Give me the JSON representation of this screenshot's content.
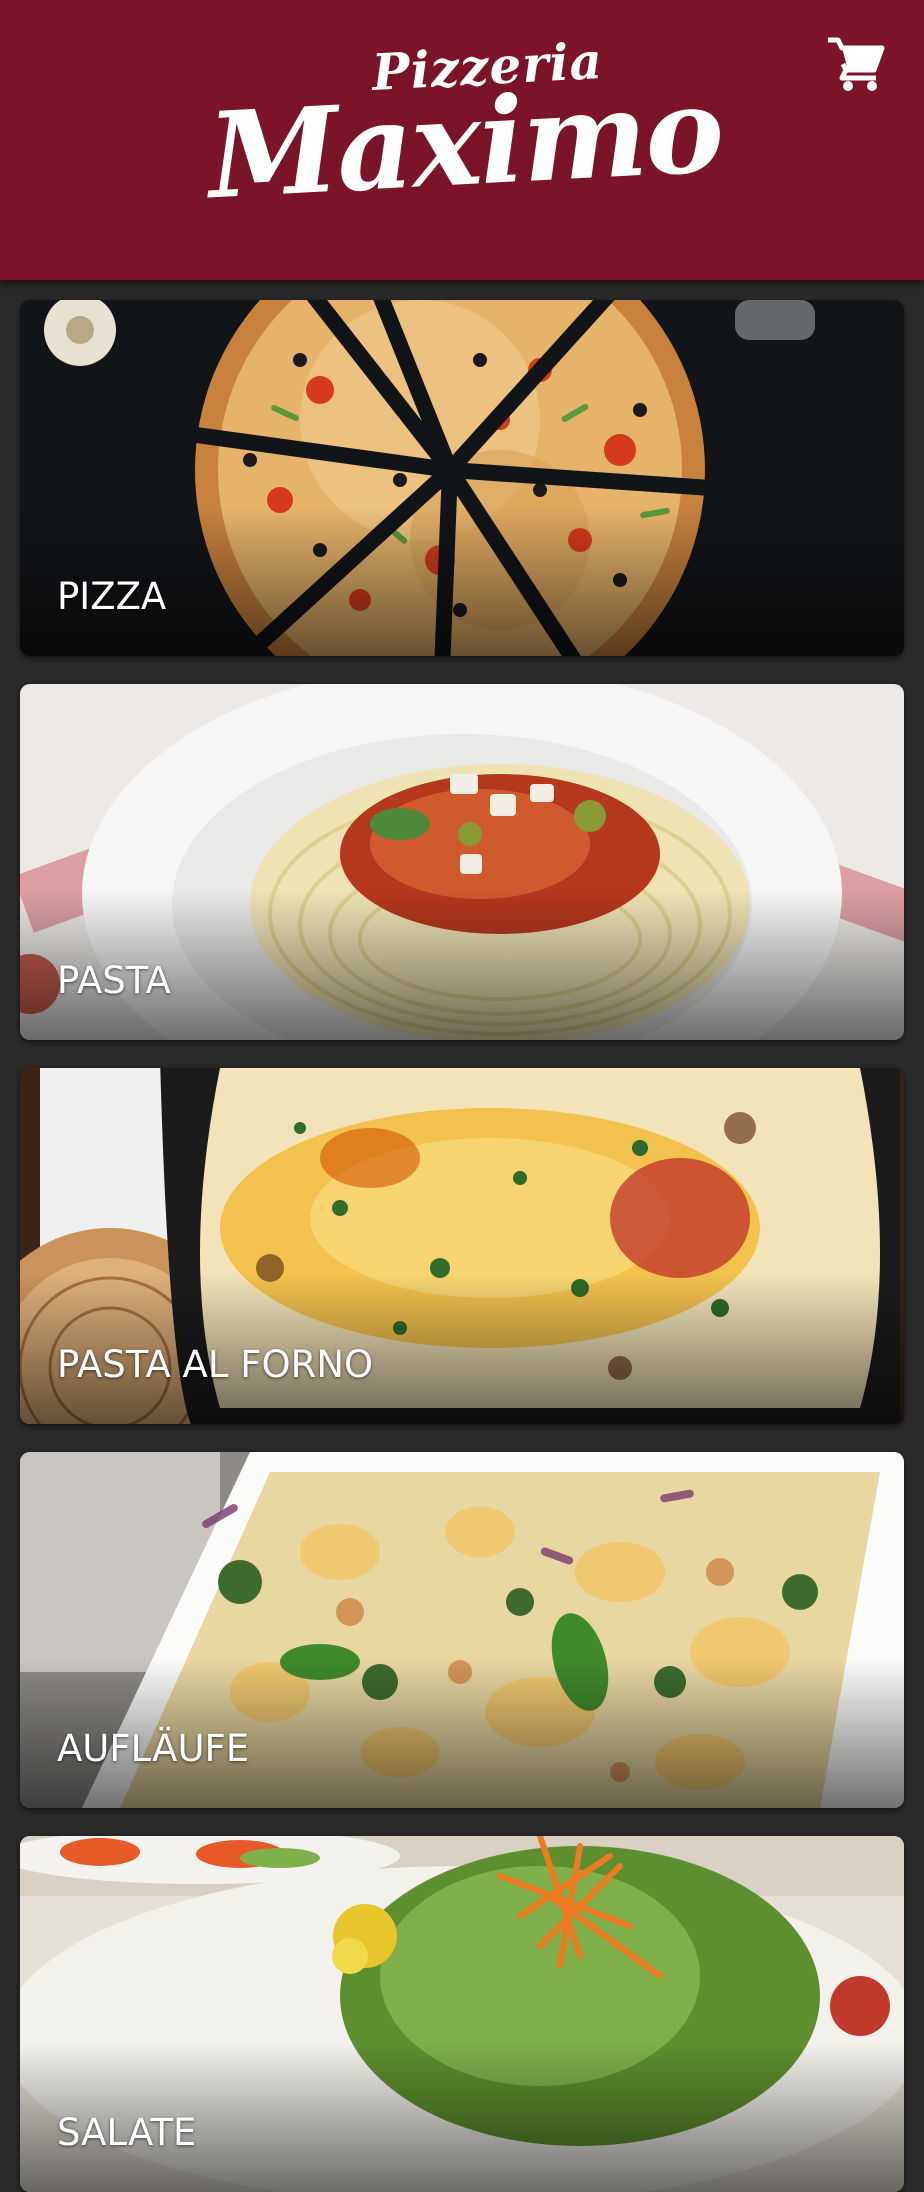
{
  "header": {
    "brand_top": "Pizzeria",
    "brand_main": "Maximo",
    "cart_icon": "shopping-cart-icon",
    "background": "#7b1428"
  },
  "categories": [
    {
      "label": "PIZZA"
    },
    {
      "label": "PASTA"
    },
    {
      "label": "PASTA AL FORNO"
    },
    {
      "label": "AUFLÄUFE"
    },
    {
      "label": "SALATE"
    }
  ]
}
